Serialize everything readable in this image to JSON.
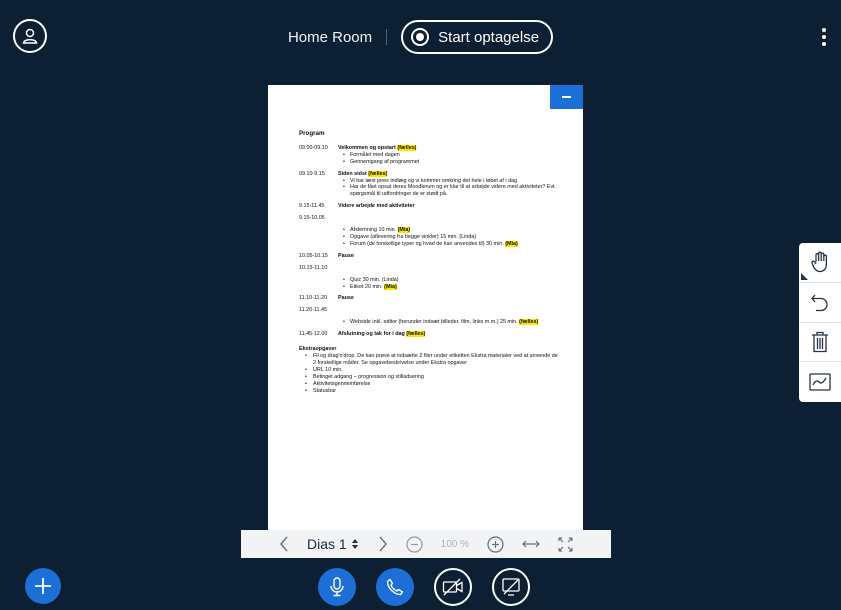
{
  "header": {
    "room_name": "Home Room",
    "record_label": "Start optagelse"
  },
  "slide": {
    "title": "Program",
    "rows": [
      {
        "time": "09.00-09.10",
        "heading": "Velkommen og opstart",
        "tag": "(fælles)",
        "bullets": [
          "Formålet med dagen",
          "Gennemgang af programmet"
        ]
      },
      {
        "time": "09.10-9.15",
        "heading": "Siden sidst",
        "tag": "(fælles)",
        "bullets": [
          "Vi har læst jeres indlæg og vi kommer omkring det hele i løbet af i dag",
          "Har de fået opsat deres Moodlerum og er klar til at arbejde videre med aktiviteter? Evt. spørgsmål til udfordringer de er stødt på."
        ]
      },
      {
        "time": "9.15-11.45",
        "heading": "Videre arbejde med aktiviteter",
        "tag": "",
        "bullets": []
      },
      {
        "time": "9.15-10.05",
        "heading": "",
        "tag": "",
        "bullets": []
      }
    ],
    "block_1005": [
      {
        "text": "Afstemning 10 min. ",
        "tag": "(Mia)"
      },
      {
        "text": "Opgave (aflevering fra begge vinkler) 15 min. (Linda)",
        "tag": ""
      },
      {
        "text": "Forum (de forskellige typer og hvad de kan anvendes til) 30 min. ",
        "tag": "(Mia)"
      }
    ],
    "pause1": {
      "time": "10.05-10.15",
      "label": "Pause"
    },
    "block_1110_time": "10.15-11.10",
    "block_1110": [
      {
        "text": "Quiz 30 min. (Linda)",
        "tag": ""
      },
      {
        "text": "Etiket 20 min. ",
        "tag": "(Mia)"
      }
    ],
    "pause2": {
      "time": "11.10-11.20",
      "label": "Pause"
    },
    "block_1145_time": "11.20-11.45",
    "block_1145": [
      {
        "text": "Webside inkl. editor (herunder indsæt billeder, film, links m.m.) 25 min. ",
        "tag": "(fælles)"
      }
    ],
    "closing": {
      "time": "11.45-12.00",
      "heading": "Afslutning og tak for i dag",
      "tag": "(fælles)"
    },
    "extra_heading": "Ekstraopgaver",
    "extra": [
      "Fil og drag'n'drop. De kan prøve at indsætte 2 filer under etiketten Ekstra materialer ved at anvende de 2 forskellige måder. Se opgavebeskrivelse under Ekstra opgaver",
      "URL 10 min.",
      "Betinget adgang – progression og stilladsering",
      "Aktivitetsgennemførelse",
      "Statusbar"
    ]
  },
  "slide_toolbar": {
    "slide_label": "Dias 1",
    "zoom": "100 %"
  },
  "colors": {
    "background": "#0d1f33",
    "accent_blue": "#1b6fd6",
    "highlight": "#ffe600"
  },
  "icons": [
    "avatar-icon",
    "record-icon",
    "kebab-menu-icon",
    "minimize-icon",
    "hand-tool-icon",
    "undo-icon",
    "trash-icon",
    "whiteboard-icon",
    "plus-icon",
    "microphone-icon",
    "phone-icon",
    "camera-off-icon",
    "screenshare-off-icon",
    "chevron-left-icon",
    "chevron-right-icon",
    "zoom-out-icon",
    "zoom-in-icon",
    "fit-width-icon",
    "fullscreen-icon"
  ]
}
